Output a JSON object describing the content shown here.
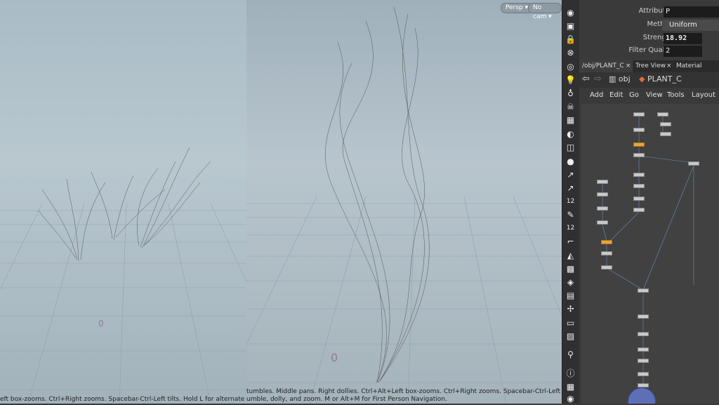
{
  "viewport_left": {
    "hud_text": "eft box-zooms. Ctrl+Right zooms. Spacebar-Ctrl-Left tilts. Hold L for alternate tumble, dolly, an"
  },
  "viewport_right": {
    "persp_label": "Persp",
    "cam_label": "No cam",
    "hud_line1": "tumbles. Middle pans. Right dollies. Ctrl+Alt+Left box-zooms. Ctrl+Right zooms. Spacebar-Ctrl-Left tilts. Hold L for",
    "hud_line2": "umble, dolly, and zoom.     M or Alt+M for First Person Navigation."
  },
  "parameters": {
    "attributes_label": "Attributes",
    "attributes_value": "P",
    "method_label": "Method",
    "method_value": "Uniform",
    "strength_label": "Strength",
    "strength_value": "18.92",
    "filter_label": "Filter Quality",
    "filter_value": "2"
  },
  "tabs": {
    "network_tab": "/obj/PLANT_C",
    "tree_tab": "Tree View",
    "material_tab": "Material Palette"
  },
  "pathbar": {
    "context": "obj",
    "node": "PLANT_C"
  },
  "menu": {
    "add": "Add",
    "edit": "Edit",
    "go": "Go",
    "view": "View",
    "tools": "Tools",
    "layout": "Layout"
  },
  "toolbar": {
    "num12a": "12",
    "num12b": "12"
  },
  "colors": {
    "node_selected": "#e8a63a",
    "node_default": "#c9c9c9",
    "network_bg": "#414141"
  }
}
